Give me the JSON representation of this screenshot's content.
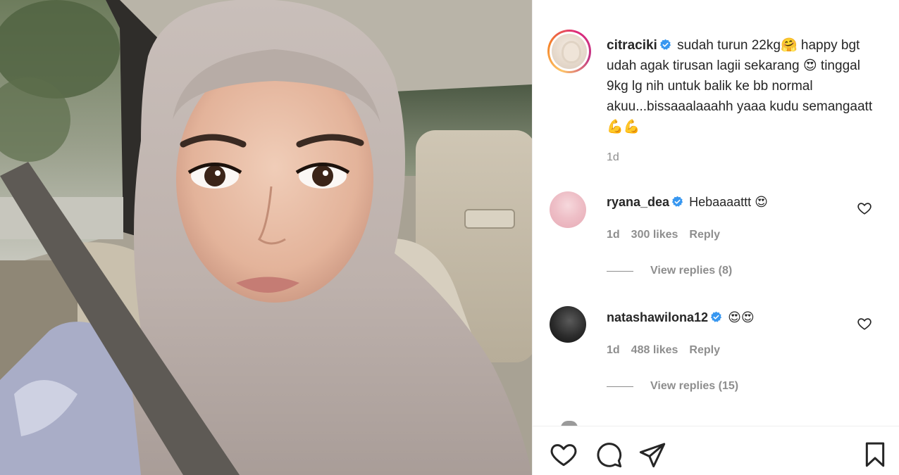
{
  "post": {
    "author": "citraciki",
    "caption": "sudah turun 22kg🤗 happy bgt udah agak tirusan lagii sekarang 😍 tinggal 9kg lg nih untuk balik ke bb normal akuu...bissaaalaaahh yaaa kudu semangaatt 💪💪",
    "time": "1d"
  },
  "comments": [
    {
      "user": "ryana_dea",
      "text": "Hebaaaattt 😍",
      "time": "1d",
      "likes": "300 likes",
      "reply": "Reply",
      "view_replies": "View replies (8)"
    },
    {
      "user": "natashawilona12",
      "text": "😍😍",
      "time": "1d",
      "likes": "488 likes",
      "reply": "Reply",
      "view_replies": "View replies (15)"
    }
  ],
  "icons": {
    "like": "heart-icon",
    "comment": "comment-icon",
    "share": "share-icon",
    "save": "bookmark-icon",
    "verified": "verified-badge-icon"
  },
  "colors": {
    "verified": "#3897f0",
    "text": "#262626",
    "muted": "#8e8e8e",
    "divider": "#efefef"
  }
}
